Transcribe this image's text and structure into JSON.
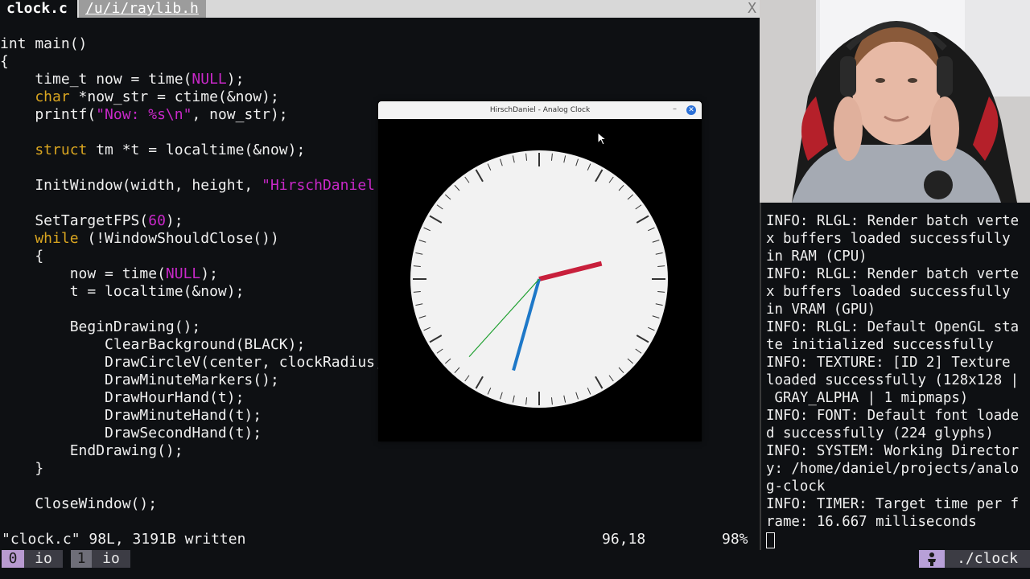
{
  "tabs": {
    "active": "clock.c",
    "inactive": " /u/i/raylib.h ",
    "close": "X"
  },
  "code": [
    [
      [
        "t",
        "int main()"
      ]
    ],
    [
      [
        "t",
        "{"
      ]
    ],
    [
      [
        "t",
        "    time_t now = time("
      ],
      [
        "mac",
        "NULL"
      ],
      [
        "t",
        ");"
      ]
    ],
    [
      [
        "kw",
        "    char"
      ],
      [
        "t",
        " *now_str = ctime(&now);"
      ]
    ],
    [
      [
        "t",
        "    printf("
      ],
      [
        "str",
        "\"Now: %s\\n\""
      ],
      [
        "t",
        ", now_str);"
      ]
    ],
    [
      [
        "t",
        ""
      ]
    ],
    [
      [
        "kw",
        "    struct"
      ],
      [
        "t",
        " tm *t = localtime(&now);"
      ]
    ],
    [
      [
        "t",
        ""
      ]
    ],
    [
      [
        "t",
        "    InitWindow(width, height, "
      ],
      [
        "str",
        "\"HirschDaniel"
      ]
    ],
    [
      [
        "t",
        ""
      ]
    ],
    [
      [
        "t",
        "    SetTargetFPS("
      ],
      [
        "mac",
        "60"
      ],
      [
        "t",
        ");"
      ]
    ],
    [
      [
        "kw",
        "    while"
      ],
      [
        "t",
        " (!WindowShouldClose())"
      ]
    ],
    [
      [
        "t",
        "    {"
      ]
    ],
    [
      [
        "t",
        "        now = time("
      ],
      [
        "mac",
        "NULL"
      ],
      [
        "t",
        ");"
      ]
    ],
    [
      [
        "t",
        "        t = localtime(&now);"
      ]
    ],
    [
      [
        "t",
        ""
      ]
    ],
    [
      [
        "t",
        "        BeginDrawing();"
      ]
    ],
    [
      [
        "t",
        "            ClearBackground(BLACK);"
      ]
    ],
    [
      [
        "t",
        "            DrawCircleV(center, clockRadius,"
      ]
    ],
    [
      [
        "t",
        "            DrawMinuteMarkers();"
      ]
    ],
    [
      [
        "t",
        "            DrawHourHand(t);"
      ]
    ],
    [
      [
        "t",
        "            DrawMinuteHand(t);"
      ]
    ],
    [
      [
        "t",
        "            DrawSecondHand(t);"
      ]
    ],
    [
      [
        "t",
        "        EndDrawing();"
      ]
    ],
    [
      [
        "t",
        "    }"
      ]
    ],
    [
      [
        "t",
        ""
      ]
    ],
    [
      [
        "t",
        "    CloseWindow();"
      ]
    ]
  ],
  "statusline": {
    "message": "\"clock.c\" 98L, 3191B written",
    "cursor": "96,18",
    "percent": "98%"
  },
  "clock_window": {
    "title": "HirschDaniel - Analog Clock",
    "minimize": "–",
    "close": "✕",
    "time": {
      "hour": 2,
      "minute": 32,
      "second": 37
    },
    "colors": {
      "background": "#000000",
      "face": "#f2f2f2",
      "markers": "#333333",
      "hour_hand": "#c8203c",
      "minute_hand": "#1e78c8",
      "second_hand": "#1fa030"
    }
  },
  "terminal_log": [
    "INFO: RLGL: Render batch verte",
    "x buffers loaded successfully",
    "in RAM (CPU)",
    "INFO: RLGL: Render batch verte",
    "x buffers loaded successfully",
    "in VRAM (GPU)",
    "INFO: RLGL: Default OpenGL sta",
    "te initialized successfully",
    "INFO: TEXTURE: [ID 2] Texture",
    "loaded successfully (128x128 |",
    " GRAY_ALPHA | 1 mipmaps)",
    "INFO: FONT: Default font loade",
    "d successfully (224 glyphs)",
    "INFO: SYSTEM: Working Director",
    "y: /home/daniel/projects/analo",
    "g-clock",
    "INFO: TIMER: Target time per f",
    "rame: 16.667 milliseconds"
  ],
  "tmux": {
    "windows": [
      {
        "index": "0",
        "name": "io"
      },
      {
        "index": "1",
        "name": "io"
      }
    ],
    "user_icon": "person-icon",
    "path": "./clock"
  }
}
